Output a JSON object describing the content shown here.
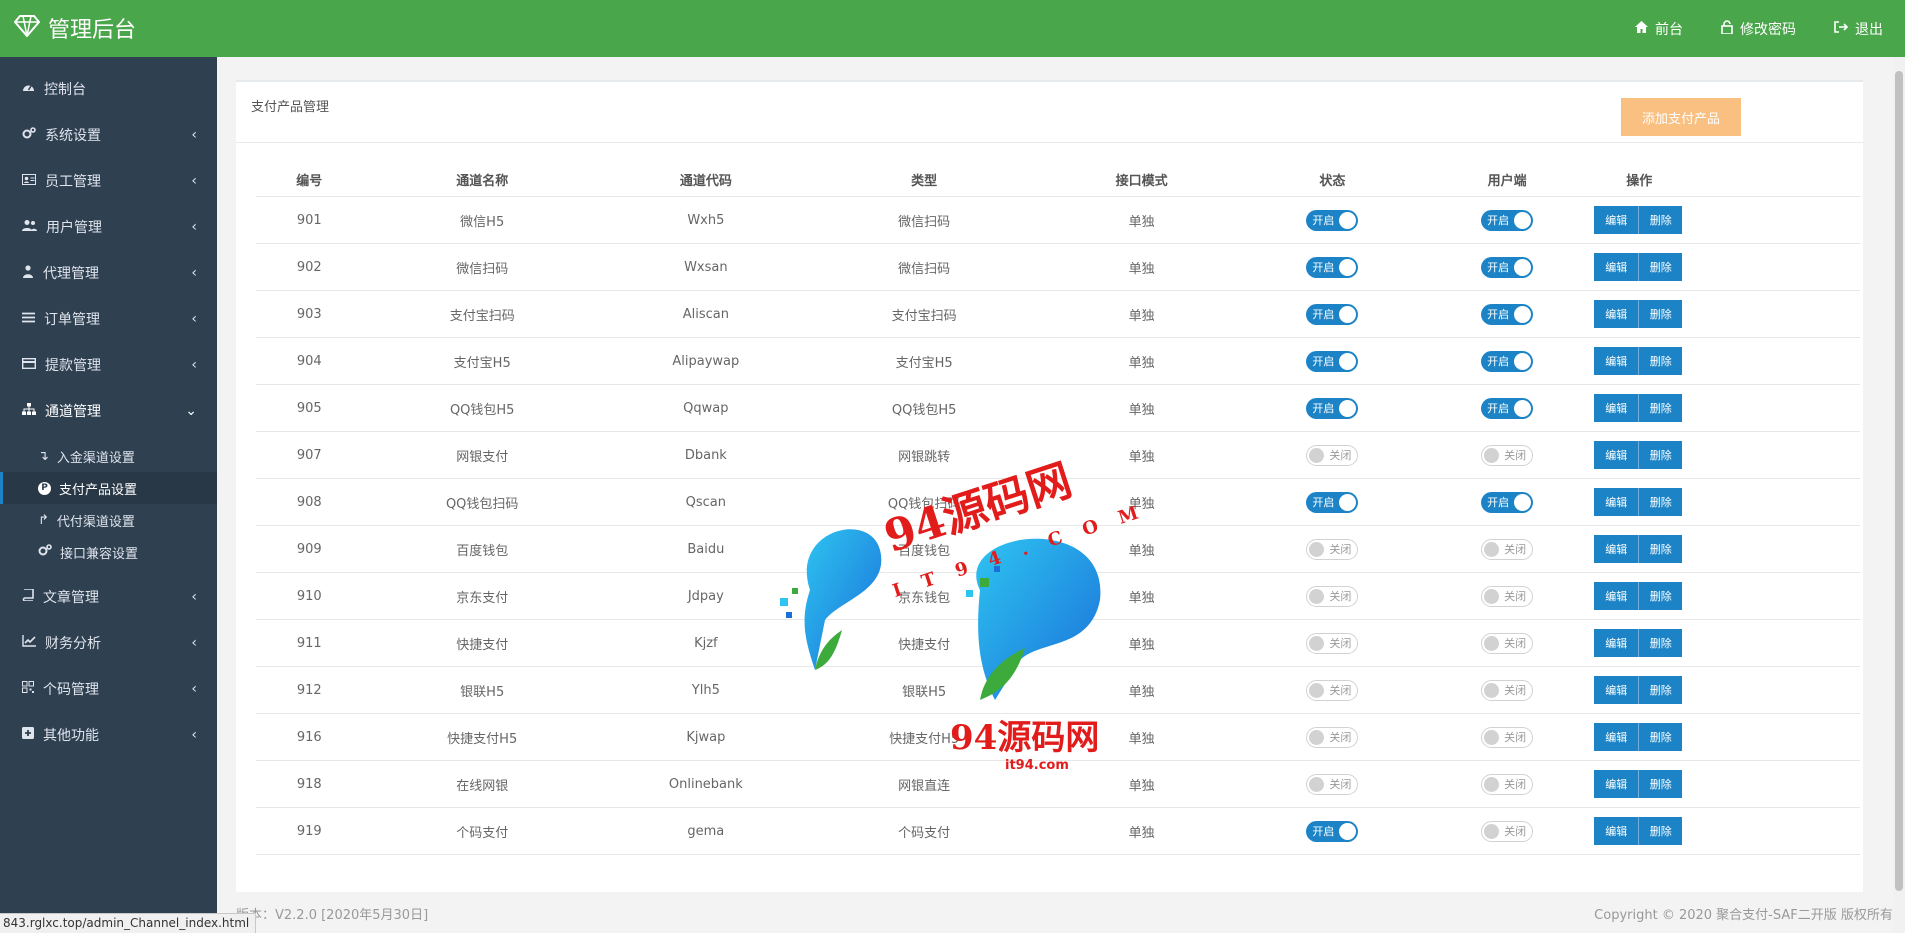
{
  "header": {
    "brand_title": "管理后台",
    "nav": [
      {
        "label": "前台",
        "icon": "home-icon"
      },
      {
        "label": "修改密码",
        "icon": "lock-icon"
      },
      {
        "label": "退出",
        "icon": "logout-icon"
      }
    ]
  },
  "sidebar": {
    "items": [
      {
        "label": "控制台",
        "icon": "dashboard-icon"
      },
      {
        "label": "系统设置",
        "icon": "gears-icon"
      },
      {
        "label": "员工管理",
        "icon": "id-card-icon"
      },
      {
        "label": "用户管理",
        "icon": "users-icon"
      },
      {
        "label": "代理管理",
        "icon": "user-tie-icon"
      },
      {
        "label": "订单管理",
        "icon": "list-icon"
      },
      {
        "label": "提款管理",
        "icon": "credit-card-icon"
      },
      {
        "label": "通道管理",
        "icon": "sitemap-icon"
      },
      {
        "label": "文章管理",
        "icon": "book-icon"
      },
      {
        "label": "财务分析",
        "icon": "chart-line-icon"
      },
      {
        "label": "个码管理",
        "icon": "qrcode-icon"
      },
      {
        "label": "其他功能",
        "icon": "plus-square-icon"
      }
    ],
    "sub_items": [
      {
        "label": "入金渠道设置",
        "icon": "arrow-down-icon"
      },
      {
        "label": "支付产品设置",
        "icon": "product-p-icon"
      },
      {
        "label": "代付渠道设置",
        "icon": "arrow-up-icon"
      },
      {
        "label": "接口兼容设置",
        "icon": "gears-icon"
      }
    ],
    "product_icon_letter": "P"
  },
  "panel": {
    "title": "支付产品管理",
    "add_button": "添加支付产品"
  },
  "table": {
    "headers": [
      "编号",
      "通道名称",
      "通道代码",
      "类型",
      "接口模式",
      "状态",
      "用户端",
      "操作"
    ],
    "rows": [
      {
        "id": "901",
        "name": "微信H5",
        "code": "Wxh5",
        "type": "微信扫码",
        "mode": "单独",
        "status": true,
        "client": true
      },
      {
        "id": "902",
        "name": "微信扫码",
        "code": "Wxsan",
        "type": "微信扫码",
        "mode": "单独",
        "status": true,
        "client": true
      },
      {
        "id": "903",
        "name": "支付宝扫码",
        "code": "Aliscan",
        "type": "支付宝扫码",
        "mode": "单独",
        "status": true,
        "client": true
      },
      {
        "id": "904",
        "name": "支付宝H5",
        "code": "Alipaywap",
        "type": "支付宝H5",
        "mode": "单独",
        "status": true,
        "client": true
      },
      {
        "id": "905",
        "name": "QQ钱包H5",
        "code": "Qqwap",
        "type": "QQ钱包H5",
        "mode": "单独",
        "status": true,
        "client": true
      },
      {
        "id": "907",
        "name": "网银支付",
        "code": "Dbank",
        "type": "网银跳转",
        "mode": "单独",
        "status": false,
        "client": false
      },
      {
        "id": "908",
        "name": "QQ钱包扫码",
        "code": "Qscan",
        "type": "QQ钱包扫码",
        "mode": "单独",
        "status": true,
        "client": true
      },
      {
        "id": "909",
        "name": "百度钱包",
        "code": "Baidu",
        "type": "百度钱包",
        "mode": "单独",
        "status": false,
        "client": false
      },
      {
        "id": "910",
        "name": "京东支付",
        "code": "Jdpay",
        "type": "京东钱包",
        "mode": "单独",
        "status": false,
        "client": false
      },
      {
        "id": "911",
        "name": "快捷支付",
        "code": "Kjzf",
        "type": "快捷支付",
        "mode": "单独",
        "status": false,
        "client": false
      },
      {
        "id": "912",
        "name": "银联H5",
        "code": "Ylh5",
        "type": "银联H5",
        "mode": "单独",
        "status": false,
        "client": false
      },
      {
        "id": "916",
        "name": "快捷支付H5",
        "code": "Kjwap",
        "type": "快捷支付H5",
        "mode": "单独",
        "status": false,
        "client": false
      },
      {
        "id": "918",
        "name": "在线网银",
        "code": "Onlinebank",
        "type": "网银直连",
        "mode": "单独",
        "status": false,
        "client": false
      },
      {
        "id": "919",
        "name": "个码支付",
        "code": "gema",
        "type": "个码支付",
        "mode": "单独",
        "status": true,
        "client": false
      }
    ],
    "toggle_on_label": "开启",
    "toggle_off_label": "关闭",
    "edit_label": "编辑",
    "delete_label": "删除"
  },
  "footer": {
    "version": "版本：V2.2.0 [2020年5月30日]",
    "copyright": "Copyright © 2020 聚合支付-SAF二开版 版权所有."
  },
  "status_url": "843.rglxc.top/admin_Channel_index.html",
  "watermark": {
    "text_top": "94源码网",
    "text_sub": "IT94.COM",
    "text_bottom": "94源码网",
    "text_url": "it94.com"
  },
  "colors": {
    "header_green": "#4aa64a",
    "sidebar_bg": "#2f4050",
    "primary_blue": "#1c84c6",
    "add_orange": "#f8ac59",
    "watermark_red": "#e21b1b"
  }
}
